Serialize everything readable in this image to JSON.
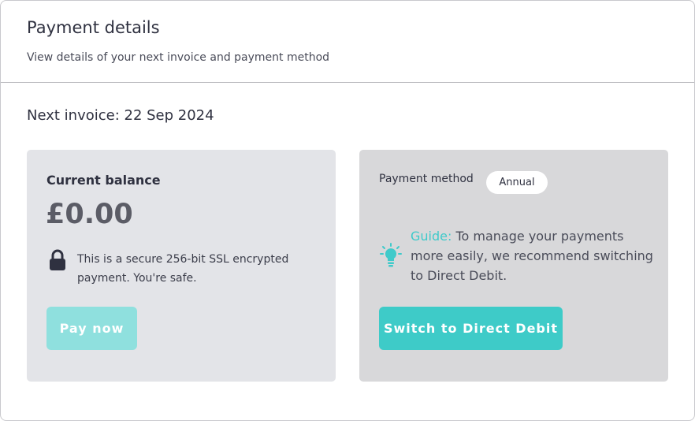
{
  "header": {
    "title": "Payment details",
    "subtitle": "View details of your next invoice and payment method"
  },
  "invoice": {
    "next_invoice_label": "Next invoice: 22 Sep 2024"
  },
  "balance_card": {
    "label": "Current balance",
    "amount": "£0.00",
    "secure_text": "This is a secure 256-bit SSL encrypted payment. You're safe.",
    "lock_icon": "lock-icon",
    "pay_button": "Pay now",
    "pay_button_color": "#8fe0de"
  },
  "method_card": {
    "label": "Payment method",
    "badge": "Annual",
    "bulb_icon": "lightbulb-icon",
    "guide_prefix": "Guide:",
    "guide_text": "To manage your payments more easily, we recommend switching to Direct Debit.",
    "switch_button": "Switch to Direct Debit",
    "accent_color": "#3ecbc8"
  }
}
